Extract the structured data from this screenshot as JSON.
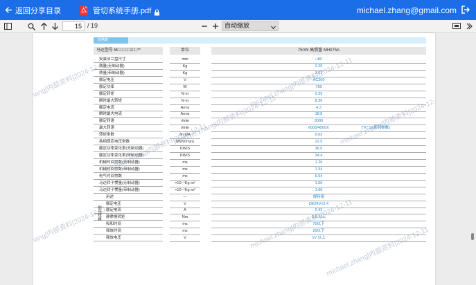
{
  "header": {
    "back_label": "返回分享目录",
    "file_title": "管切系统手册.pdf",
    "user_email": "michael.zhang@gmail.com"
  },
  "toolbar": {
    "current_page": "15",
    "total_pages": "/ 19",
    "zoom_label": "自动缩放"
  },
  "document": {
    "section_tag": "规格表",
    "model_label": "马达型号 M□□□□□2□□**",
    "unit_head": "单位",
    "value_head": "750W 高惯量 MH075A",
    "brake_group_label": "刹车规格",
    "note": "(\"X\"    S2系列参数)",
    "watermark": "michael.zhang|内部资料|2024-12-11",
    "rows": [
      {
        "name": "安装法兰盘尺寸",
        "unit": "mm",
        "value": "□80"
      },
      {
        "name": "质量(无制动器)",
        "unit": "Kg",
        "value": "2.25"
      },
      {
        "name": "质量(带制动器)",
        "unit": "Kg",
        "value": "3.01"
      },
      {
        "name": "额定电压",
        "unit": "V",
        "value": "AC200"
      },
      {
        "name": "额定功率",
        "unit": "W",
        "value": "750"
      },
      {
        "name": "额定转矩",
        "unit": "N·m",
        "value": "2.39"
      },
      {
        "name": "瞬时最大转矩",
        "unit": "N·m",
        "value": "8.36"
      },
      {
        "name": "额定电流",
        "unit": "Arms",
        "value": "4.3"
      },
      {
        "name": "瞬时最大电流",
        "unit": "Arms",
        "value": "18.8"
      },
      {
        "name": "额定转速",
        "unit": "r/min",
        "value": "3000"
      },
      {
        "name": "最大转速",
        "unit": "r/min",
        "value": "6000/4500X"
      },
      {
        "name": "转矩常数",
        "unit": "N·m/A",
        "value": "0.63"
      },
      {
        "name": "各相感应电压常数",
        "unit": "MV/(r/min)",
        "value": "22.5"
      },
      {
        "name": "额定功率变化率(无制动器)",
        "unit": "KW/S",
        "value": "36.6"
      },
      {
        "name": "额定功率变化率(带制动器)",
        "unit": "KW/S",
        "value": "34.4"
      },
      {
        "name": "机械时间常数(无制动器)",
        "unit": "ms",
        "value": "1.26"
      },
      {
        "name": "机械时间常数(带制动器)",
        "unit": "ms",
        "value": "1.34"
      },
      {
        "name": "电气时间常数",
        "unit": "ms",
        "value": "6.54"
      },
      {
        "name": "马达转子惯量(无制动器)",
        "unit": "×10⁻⁴Kg·m²",
        "value": "1.56"
      },
      {
        "name": "马达转子惯量(带制动器)",
        "unit": "×10⁻⁴Kg·m²",
        "value": "1.66"
      },
      {
        "name": "用途",
        "unit": "—",
        "value": "保持用"
      },
      {
        "name": "额定电压",
        "unit": "V",
        "value": "DE24V±2.4"
      },
      {
        "name": "额定电流",
        "unit": "A",
        "value": "0.42"
      },
      {
        "name": "静摩擦转矩",
        "unit": "Nm",
        "value": "3.8 以上"
      },
      {
        "name": "吸和时间",
        "unit": "ms",
        "value": "70以下"
      },
      {
        "name": "释放时间",
        "unit": "ms",
        "value": "20以下"
      },
      {
        "name": "释放电压",
        "unit": "V",
        "value": "1V 以上"
      }
    ]
  },
  "colors": {
    "header_bg": "#1b6ee8",
    "value_text": "#1a8ad4",
    "pdf_badge": "#e53935"
  }
}
